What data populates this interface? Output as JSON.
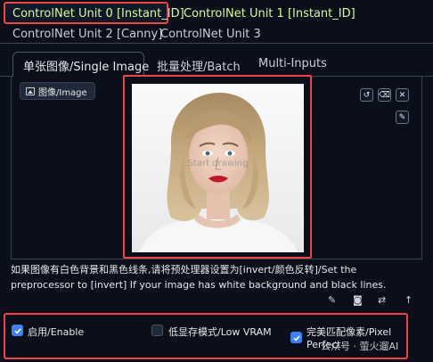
{
  "unit_tabs": [
    {
      "label": "ControlNet Unit 0 [Instant_ID]"
    },
    {
      "label": "ControlNet Unit 1 [Instant_ID]"
    },
    {
      "label": "ControlNet Unit 2 [Canny]"
    },
    {
      "label": "ControlNet Unit 3"
    }
  ],
  "inner_tabs": [
    {
      "label": "单张图像/Single Image"
    },
    {
      "label": "批量处理/Batch"
    },
    {
      "label": "Multi-Inputs"
    }
  ],
  "image_panel": {
    "chip_label": "图像/Image",
    "canvas_watermark": "Start drawing"
  },
  "description": "如果图像有白色背景和黑色线条,请将预处理器设置为[invert/颜色反转]/Set the preprocessor to [invert] If your image has white background and black lines.",
  "options": {
    "enable": {
      "label": "启用/Enable",
      "checked": true
    },
    "low_vram": {
      "label": "低显存模式/Low VRAM",
      "checked": false
    },
    "pixel_perfect": {
      "label_line1": "完美匹配像素/Pixel",
      "label_line2": "Perfect",
      "checked": true
    }
  },
  "footer_watermark": "公众号 · 萤火遛AI",
  "colors": {
    "accent_green": "#d9f99d",
    "highlight_red": "#ef4444",
    "checkbox_blue": "#3b82f6",
    "bg": "#0b0f19"
  },
  "icons": [
    "image-icon",
    "undo-icon",
    "eraser-icon",
    "close-icon",
    "edit-pen-icon",
    "pencil-icon",
    "camera-icon",
    "swap-icon",
    "upload-arrow-icon",
    "check-icon"
  ]
}
